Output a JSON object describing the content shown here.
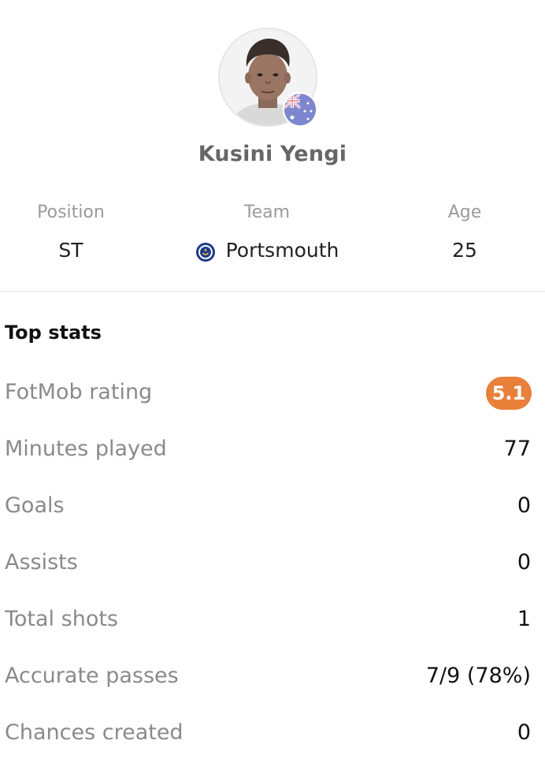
{
  "player": {
    "name": "Kusini Yengi",
    "photo_icon": "player-photo",
    "nationality_icon": "australia-flag-icon"
  },
  "info": {
    "position_label": "Position",
    "position_value": "ST",
    "team_label": "Team",
    "team_value": "Portsmouth",
    "team_icon": "portsmouth-crest-icon",
    "age_label": "Age",
    "age_value": "25"
  },
  "top_stats": {
    "title": "Top stats",
    "rating": {
      "label": "FotMob rating",
      "value": "5.1",
      "badge_color": "#e8803a"
    },
    "rows": [
      {
        "label": "Minutes played",
        "value": "77"
      },
      {
        "label": "Goals",
        "value": "0"
      },
      {
        "label": "Assists",
        "value": "0"
      },
      {
        "label": "Total shots",
        "value": "1"
      },
      {
        "label": "Accurate passes",
        "value": "7/9 (78%)"
      },
      {
        "label": "Chances created",
        "value": "0"
      }
    ]
  }
}
